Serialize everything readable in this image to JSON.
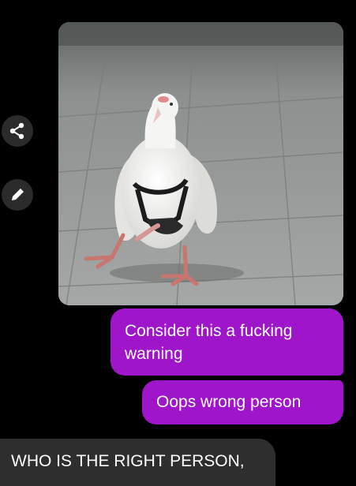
{
  "conversation": {
    "photo_message": {
      "image_description_icon": "pigeon-photo"
    },
    "side_actions": {
      "share_icon": "share-icon",
      "edit_icon": "pencil-icon"
    },
    "sent_messages": [
      {
        "text": "Consider this a fucking warning"
      },
      {
        "text": "Oops wrong person"
      }
    ],
    "received_messages": [
      {
        "text": "WHO IS THE RIGHT PERSON,"
      }
    ]
  },
  "colors": {
    "background": "#000000",
    "sent_bubble": "#9f15c9",
    "received_bubble": "#2e2e2e",
    "side_button": "#2b2b2b"
  }
}
